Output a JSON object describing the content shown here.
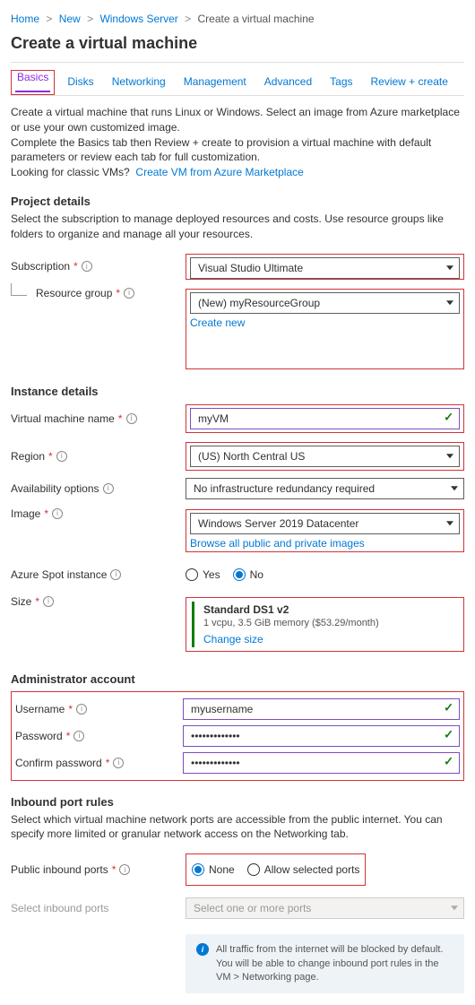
{
  "breadcrumb": {
    "home": "Home",
    "new": "New",
    "ws": "Windows Server",
    "current": "Create a virtual machine"
  },
  "title": "Create a virtual machine",
  "tabs": {
    "basics": "Basics",
    "disks": "Disks",
    "networking": "Networking",
    "management": "Management",
    "advanced": "Advanced",
    "tags": "Tags",
    "review": "Review + create"
  },
  "intro": {
    "p1": "Create a virtual machine that runs Linux or Windows. Select an image from Azure marketplace or use your own customized image.",
    "p2": "Complete the Basics tab then Review + create to provision a virtual machine with default parameters or review each tab for full customization.",
    "classic_q": "Looking for classic VMs?",
    "classic_link": "Create VM from Azure Marketplace"
  },
  "project": {
    "heading": "Project details",
    "desc": "Select the subscription to manage deployed resources and costs. Use resource groups like folders to organize and manage all your resources.",
    "subscription_label": "Subscription",
    "subscription_value": "Visual Studio Ultimate",
    "rg_label": "Resource group",
    "rg_value": "(New) myResourceGroup",
    "rg_create": "Create new"
  },
  "instance": {
    "heading": "Instance details",
    "vmname_label": "Virtual machine name",
    "vmname_value": "myVM",
    "region_label": "Region",
    "region_value": "(US) North Central US",
    "avail_label": "Availability options",
    "avail_value": "No infrastructure redundancy required",
    "image_label": "Image",
    "image_value": "Windows Server 2019 Datacenter",
    "image_browse": "Browse all public and private images",
    "spot_label": "Azure Spot instance",
    "spot_yes": "Yes",
    "spot_no": "No",
    "size_label": "Size",
    "size_title": "Standard DS1 v2",
    "size_spec": "1 vcpu, 3.5 GiB memory ($53.29/month)",
    "size_change": "Change size"
  },
  "admin": {
    "heading": "Administrator account",
    "user_label": "Username",
    "user_value": "myusername",
    "pw_label": "Password",
    "pw_value": "•••••••••••••",
    "cpw_label": "Confirm password",
    "cpw_value": "•••••••••••••"
  },
  "ports": {
    "heading": "Inbound port rules",
    "desc": "Select which virtual machine network ports are accessible from the public internet. You can specify more limited or granular network access on the Networking tab.",
    "public_label": "Public inbound ports",
    "none": "None",
    "allow": "Allow selected ports",
    "select_label": "Select inbound ports",
    "select_placeholder": "Select one or more ports",
    "info_text": "All traffic from the internet will be blocked by default. You will be able to change inbound port rules in the VM > Networking page."
  }
}
